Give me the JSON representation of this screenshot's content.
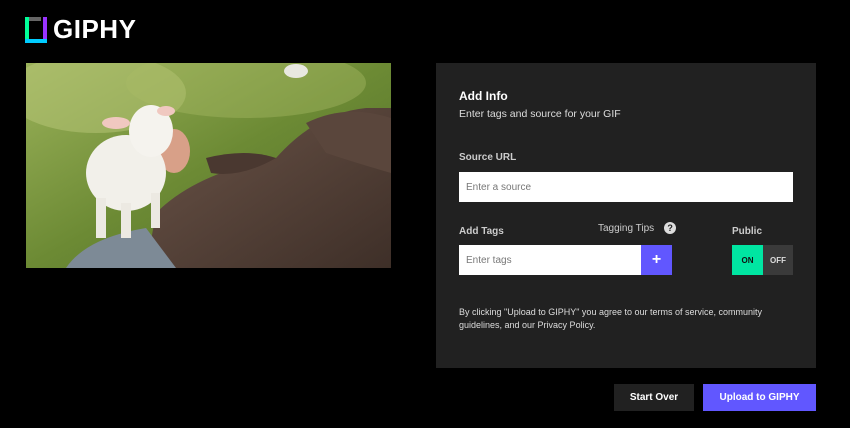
{
  "brand": {
    "name": "GIPHY"
  },
  "panel": {
    "title": "Add Info",
    "subtitle": "Enter tags and source for your GIF",
    "source_label": "Source URL",
    "source_placeholder": "Enter a source",
    "tags_label": "Add Tags",
    "tags_placeholder": "Enter tags",
    "add_tag_symbol": "+",
    "tips_label": "Tagging Tips",
    "tips_icon": "?",
    "public_label": "Public",
    "toggle_on": "ON",
    "toggle_off": "OFF",
    "agreement": "By clicking \"Upload to GIPHY\" you agree to our terms of service, community guidelines, and our Privacy Policy."
  },
  "actions": {
    "start_over": "Start Over",
    "upload": "Upload to GIPHY"
  },
  "colors": {
    "accent": "#6157ff",
    "toggle_on": "#00e6a2",
    "panel_bg": "#212121"
  }
}
